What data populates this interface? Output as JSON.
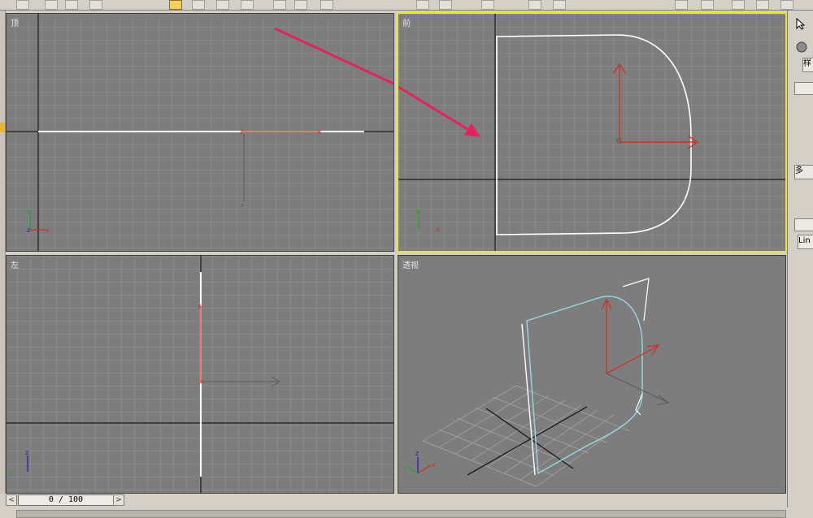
{
  "viewports": {
    "top": {
      "label": "顶"
    },
    "front": {
      "label": "前"
    },
    "left": {
      "label": "左"
    },
    "perspective": {
      "label": "透视"
    }
  },
  "right_panel": {
    "field1": "样",
    "field2": "多",
    "field3": "Lin"
  },
  "timeline": {
    "frame_display": "0 / 100",
    "prev_arrow": "<",
    "next_arrow": ">"
  },
  "icons": [
    "select-arrow-icon",
    "sphere-icon",
    "prev-frame-icon",
    "next-frame-icon"
  ],
  "colors": {
    "viewport_bg": "#7d7d7d",
    "active_border": "#e6e62c",
    "annotation_arrow": "#e0245e",
    "axis_red": "#d42a1e"
  }
}
